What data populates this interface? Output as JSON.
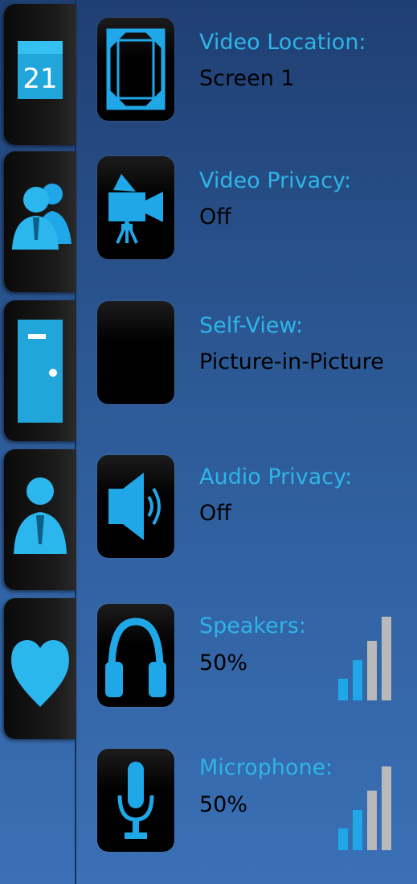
{
  "sidebar": {
    "tabs": [
      {
        "name": "calendar",
        "icon": "calendar-icon",
        "date": "21"
      },
      {
        "name": "contacts",
        "icon": "people-icon"
      },
      {
        "name": "rooms",
        "icon": "door-icon"
      },
      {
        "name": "profile",
        "icon": "person-icon"
      },
      {
        "name": "favorites",
        "icon": "heart-icon"
      }
    ]
  },
  "settings": {
    "video_location": {
      "label": "Video Location:",
      "value": "Screen 1",
      "icon": "screen-frame-icon"
    },
    "video_privacy": {
      "label": "Video Privacy:",
      "value": "Off",
      "icon": "video-camera-icon"
    },
    "self_view": {
      "label": "Self-View:",
      "value": "Picture-in-Picture",
      "icon": "blank-tile"
    },
    "audio_privacy": {
      "label": "Audio Privacy:",
      "value": "Off",
      "icon": "speaker-icon"
    },
    "speakers": {
      "label": "Speakers:",
      "value": "50%",
      "icon": "headphones-icon",
      "level": 0.5
    },
    "microphone": {
      "label": "Microphone:",
      "value": "50%",
      "icon": "microphone-icon",
      "level": 0.5
    }
  },
  "colors": {
    "accent": "#2fb4e8",
    "bar_active": "#1fa7e8",
    "bar_inactive": "#b9b9b9"
  }
}
